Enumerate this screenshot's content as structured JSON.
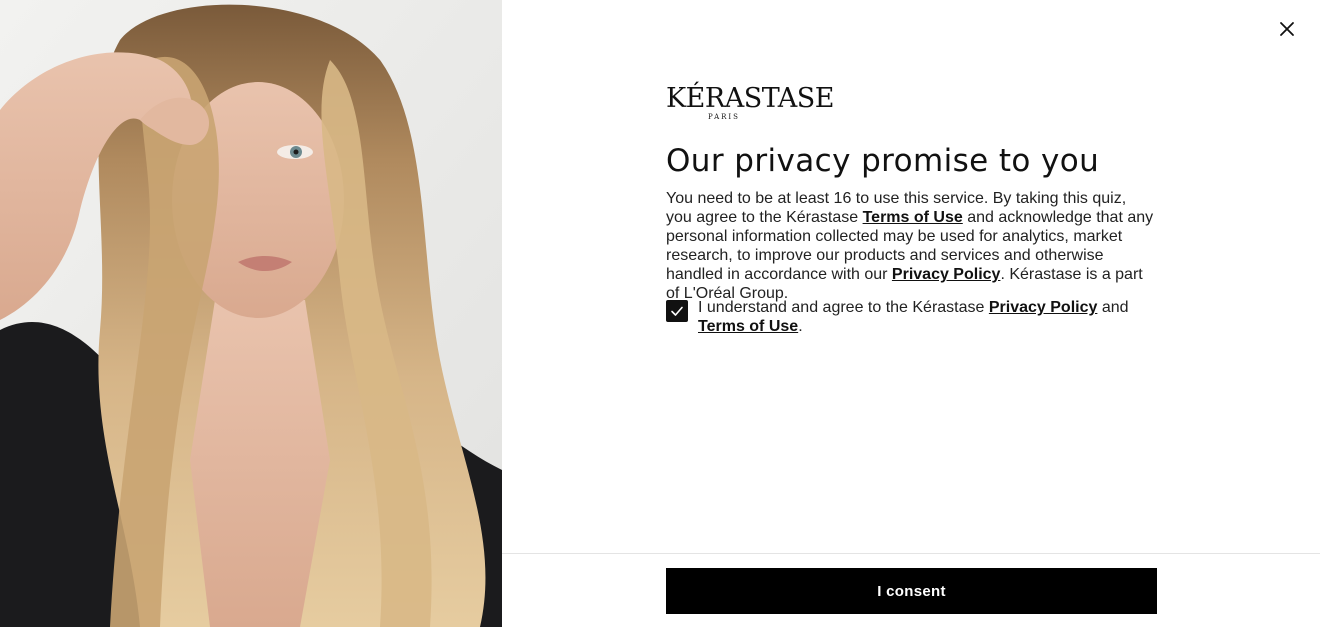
{
  "brand": {
    "logo_text": "KÉRASTASE",
    "logo_subtext": "PARIS"
  },
  "modal": {
    "title": "Our privacy promise to you",
    "body": {
      "part1": "You need to be at least 16 to use this service. By taking this quiz, you agree to the Kérastase ",
      "terms_link": "Terms of Use",
      "part2": " and acknowledge that any personal information collected may be used for analytics, market research, to improve our products and services and otherwise handled in accordance with our ",
      "privacy_link": "Privacy Policy",
      "part3": ". Kérastase is a part of L'Oréal Group."
    },
    "consent": {
      "checked": true,
      "part1": "I understand and agree to the Kérastase ",
      "privacy_link": "Privacy Policy",
      "part2": " and ",
      "terms_link": "Terms of Use",
      "part3": "."
    },
    "consent_button": "I consent"
  },
  "icons": {
    "close": "close-icon",
    "checkmark": "checkmark-icon"
  },
  "colors": {
    "primary": "#000000",
    "background": "#ffffff",
    "text": "#1a1a1a",
    "divider": "#e4e4e4"
  }
}
